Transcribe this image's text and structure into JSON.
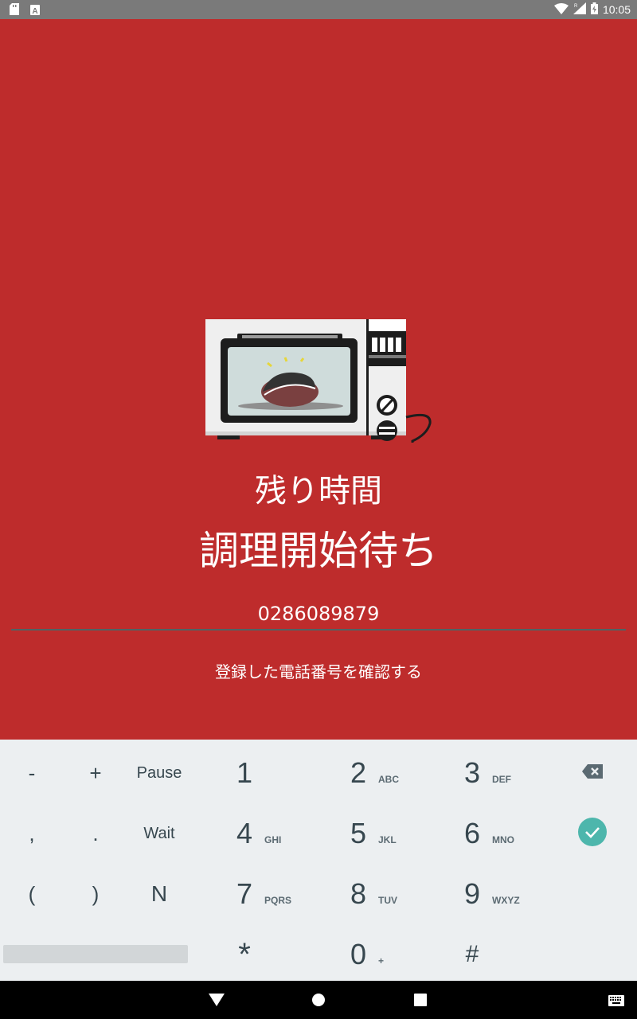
{
  "status_bar": {
    "time": "10:05",
    "icons": [
      "sd-card-icon",
      "text-a-icon",
      "wifi-icon",
      "signal-icon",
      "battery-charging-icon"
    ]
  },
  "main": {
    "image": "microwave-oven-illustration",
    "remaining_time_label": "残り時間",
    "cooking_status": "調理開始待ち",
    "phone_number": "0286089879",
    "confirm_phone_link": "登録した電話番号を確認する"
  },
  "keyboard": {
    "symbols": {
      "minus": "-",
      "plus": "+",
      "pause": "Pause",
      "comma": ",",
      "period": ".",
      "wait": "Wait",
      "open_paren": "(",
      "close_paren": ")",
      "n": "N"
    },
    "digits": [
      {
        "digit": "1",
        "letters": ""
      },
      {
        "digit": "2",
        "letters": "ABC"
      },
      {
        "digit": "3",
        "letters": "DEF"
      },
      {
        "digit": "4",
        "letters": "GHI"
      },
      {
        "digit": "5",
        "letters": "JKL"
      },
      {
        "digit": "6",
        "letters": "MNO"
      },
      {
        "digit": "7",
        "letters": "PQRS"
      },
      {
        "digit": "8",
        "letters": "TUV"
      },
      {
        "digit": "9",
        "letters": "WXYZ"
      },
      {
        "digit": "*",
        "letters": ""
      },
      {
        "digit": "0",
        "letters": "+"
      },
      {
        "digit": "#",
        "letters": ""
      }
    ],
    "action_icons": [
      "backspace-icon",
      "done-check-icon"
    ]
  },
  "nav_bar": {
    "icons": [
      "back-icon",
      "home-icon",
      "recents-icon",
      "keyboard-switch-icon"
    ]
  },
  "colors": {
    "background": "#be2c2c",
    "keyboard": "#eceff1",
    "accent": "#4db6ac",
    "status_bar": "#7a7a7a"
  }
}
